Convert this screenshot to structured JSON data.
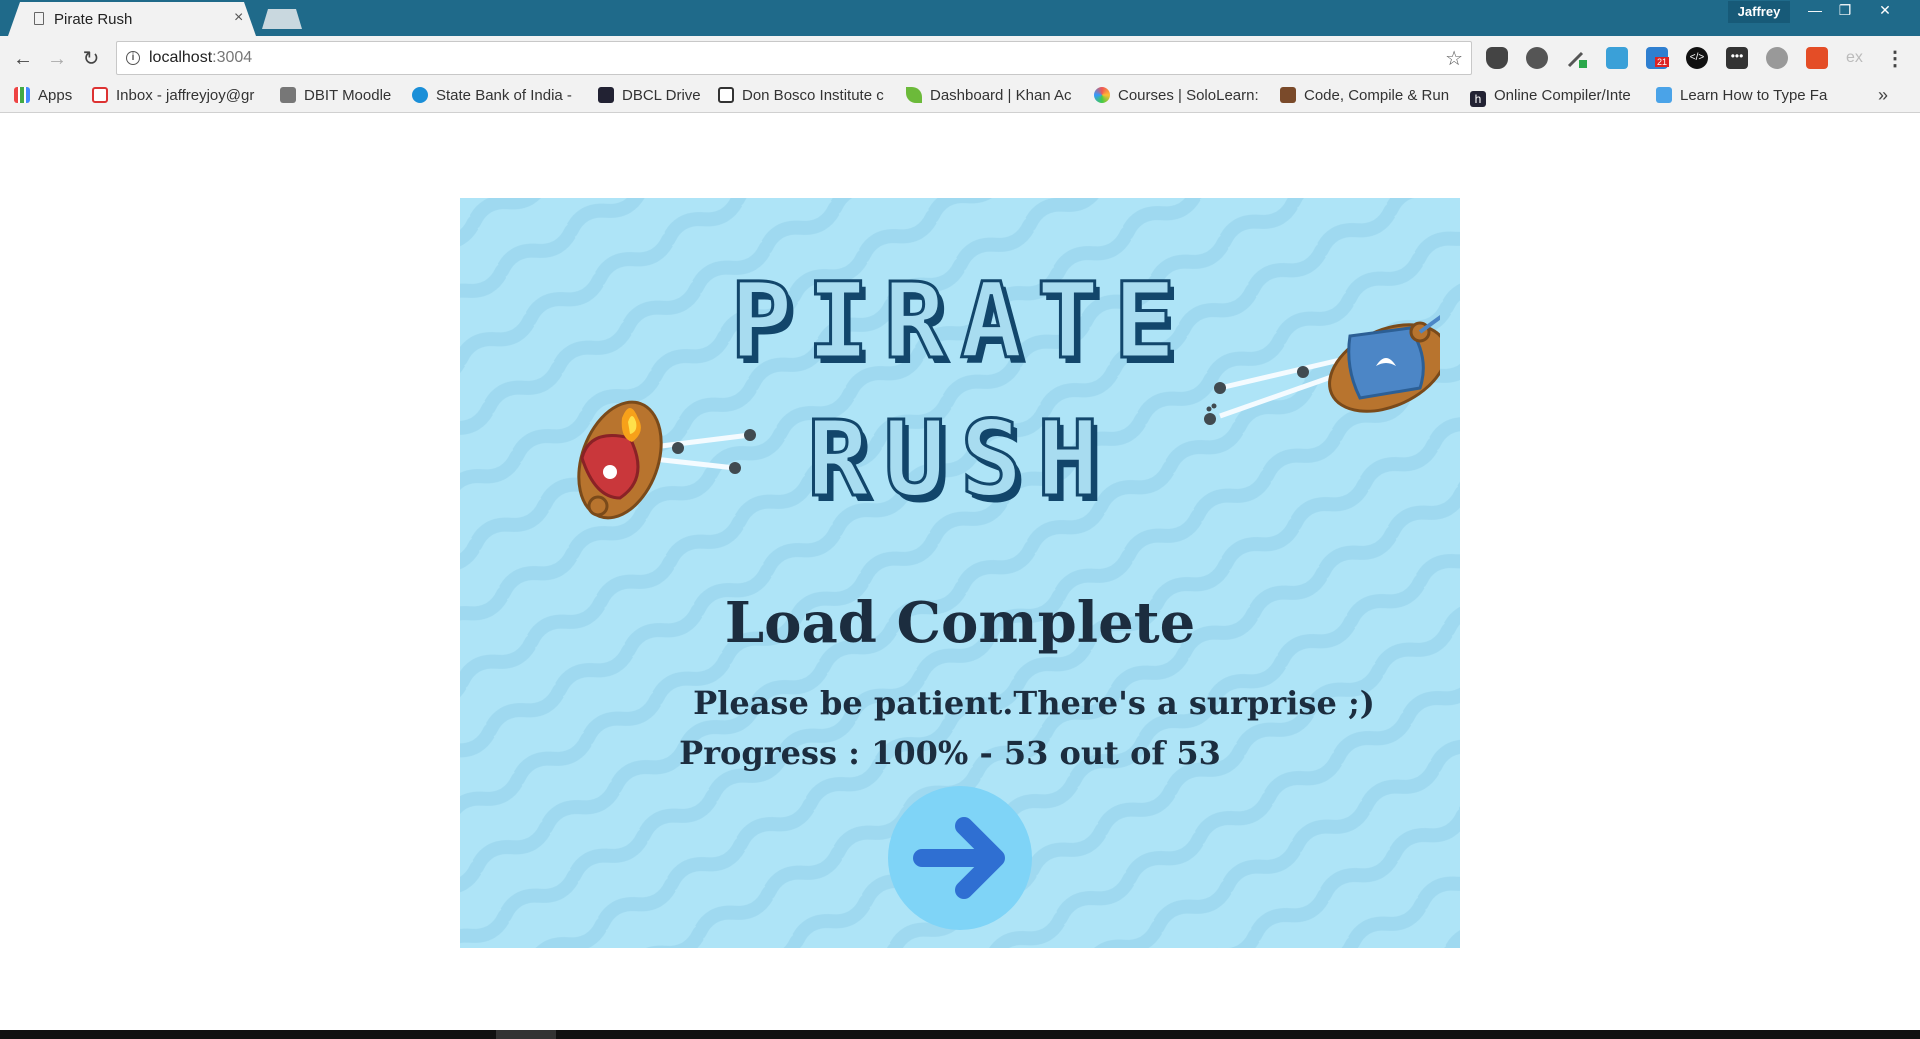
{
  "browser": {
    "tab": {
      "title": "Pirate Rush",
      "close": "×"
    },
    "profile": "Jaffrey",
    "window_controls": {
      "minimize": "—",
      "restore": "❐",
      "close": "✕"
    },
    "nav": {
      "back": "←",
      "forward": "→",
      "reload": "↻"
    },
    "address": {
      "host": "localhost",
      "port": ":3004",
      "star": "☆"
    },
    "extensions": [
      "pocket-icon",
      "evernote-icon",
      "eyedropper-icon",
      "window-icon",
      "calendar-icon",
      "code-icon",
      "dots-icon",
      "settings-icon",
      "html5-icon",
      "ex-icon"
    ],
    "extension_badge": "21",
    "extension_ex_label": "ex",
    "menu": "⋮",
    "bookmarks": [
      {
        "label": "Apps",
        "icon": "apps-grid-icon"
      },
      {
        "label": "Inbox - jaffreyjoy@gr",
        "icon": "gmail-icon"
      },
      {
        "label": "DBIT Moodle",
        "icon": "moodle-icon"
      },
      {
        "label": "State Bank of India -",
        "icon": "sbi-icon"
      },
      {
        "label": "DBCL Drive",
        "icon": "cloud-icon"
      },
      {
        "label": "Don Bosco Institute c",
        "icon": "dbit-icon"
      },
      {
        "label": "Dashboard | Khan Ac",
        "icon": "khan-leaf-icon"
      },
      {
        "label": "Courses | SoloLearn:",
        "icon": "sololearn-icon"
      },
      {
        "label": "Code, Compile & Run",
        "icon": "codechef-icon"
      },
      {
        "label": "Online Compiler/Inte",
        "icon": "h-icon"
      },
      {
        "label": "Learn How to Type Fa",
        "icon": "typing-icon"
      }
    ],
    "bookmarks_more": "»"
  },
  "game": {
    "title_line1": "PIRATE",
    "title_line2": "RUSH",
    "status": "Load Complete",
    "message": "Please be patient.There's a surprise ;)",
    "progress_text": "Progress : 100% - 53 out of 53",
    "progress": {
      "percent": 100,
      "loaded": 53,
      "total": 53
    },
    "next_button_icon": "arrow-right-icon",
    "colors": {
      "background": "#aee4f7",
      "title_stroke": "#12466b",
      "text": "#1c2d3f",
      "button": "#7fd4f7",
      "arrow": "#2f6fd2"
    }
  }
}
